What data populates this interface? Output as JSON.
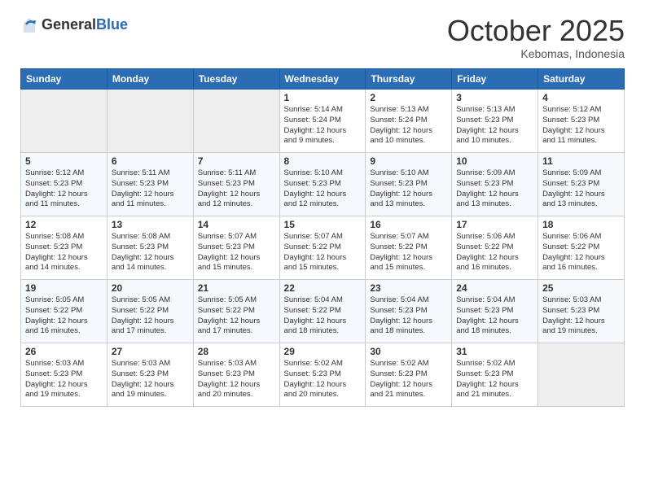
{
  "header": {
    "logo_general": "General",
    "logo_blue": "Blue",
    "month": "October 2025",
    "location": "Kebomas, Indonesia"
  },
  "days_of_week": [
    "Sunday",
    "Monday",
    "Tuesday",
    "Wednesday",
    "Thursday",
    "Friday",
    "Saturday"
  ],
  "weeks": [
    [
      {
        "day": "",
        "info": ""
      },
      {
        "day": "",
        "info": ""
      },
      {
        "day": "",
        "info": ""
      },
      {
        "day": "1",
        "info": "Sunrise: 5:14 AM\nSunset: 5:24 PM\nDaylight: 12 hours\nand 9 minutes."
      },
      {
        "day": "2",
        "info": "Sunrise: 5:13 AM\nSunset: 5:24 PM\nDaylight: 12 hours\nand 10 minutes."
      },
      {
        "day": "3",
        "info": "Sunrise: 5:13 AM\nSunset: 5:23 PM\nDaylight: 12 hours\nand 10 minutes."
      },
      {
        "day": "4",
        "info": "Sunrise: 5:12 AM\nSunset: 5:23 PM\nDaylight: 12 hours\nand 11 minutes."
      }
    ],
    [
      {
        "day": "5",
        "info": "Sunrise: 5:12 AM\nSunset: 5:23 PM\nDaylight: 12 hours\nand 11 minutes."
      },
      {
        "day": "6",
        "info": "Sunrise: 5:11 AM\nSunset: 5:23 PM\nDaylight: 12 hours\nand 11 minutes."
      },
      {
        "day": "7",
        "info": "Sunrise: 5:11 AM\nSunset: 5:23 PM\nDaylight: 12 hours\nand 12 minutes."
      },
      {
        "day": "8",
        "info": "Sunrise: 5:10 AM\nSunset: 5:23 PM\nDaylight: 12 hours\nand 12 minutes."
      },
      {
        "day": "9",
        "info": "Sunrise: 5:10 AM\nSunset: 5:23 PM\nDaylight: 12 hours\nand 13 minutes."
      },
      {
        "day": "10",
        "info": "Sunrise: 5:09 AM\nSunset: 5:23 PM\nDaylight: 12 hours\nand 13 minutes."
      },
      {
        "day": "11",
        "info": "Sunrise: 5:09 AM\nSunset: 5:23 PM\nDaylight: 12 hours\nand 13 minutes."
      }
    ],
    [
      {
        "day": "12",
        "info": "Sunrise: 5:08 AM\nSunset: 5:23 PM\nDaylight: 12 hours\nand 14 minutes."
      },
      {
        "day": "13",
        "info": "Sunrise: 5:08 AM\nSunset: 5:23 PM\nDaylight: 12 hours\nand 14 minutes."
      },
      {
        "day": "14",
        "info": "Sunrise: 5:07 AM\nSunset: 5:23 PM\nDaylight: 12 hours\nand 15 minutes."
      },
      {
        "day": "15",
        "info": "Sunrise: 5:07 AM\nSunset: 5:22 PM\nDaylight: 12 hours\nand 15 minutes."
      },
      {
        "day": "16",
        "info": "Sunrise: 5:07 AM\nSunset: 5:22 PM\nDaylight: 12 hours\nand 15 minutes."
      },
      {
        "day": "17",
        "info": "Sunrise: 5:06 AM\nSunset: 5:22 PM\nDaylight: 12 hours\nand 16 minutes."
      },
      {
        "day": "18",
        "info": "Sunrise: 5:06 AM\nSunset: 5:22 PM\nDaylight: 12 hours\nand 16 minutes."
      }
    ],
    [
      {
        "day": "19",
        "info": "Sunrise: 5:05 AM\nSunset: 5:22 PM\nDaylight: 12 hours\nand 16 minutes."
      },
      {
        "day": "20",
        "info": "Sunrise: 5:05 AM\nSunset: 5:22 PM\nDaylight: 12 hours\nand 17 minutes."
      },
      {
        "day": "21",
        "info": "Sunrise: 5:05 AM\nSunset: 5:22 PM\nDaylight: 12 hours\nand 17 minutes."
      },
      {
        "day": "22",
        "info": "Sunrise: 5:04 AM\nSunset: 5:22 PM\nDaylight: 12 hours\nand 18 minutes."
      },
      {
        "day": "23",
        "info": "Sunrise: 5:04 AM\nSunset: 5:23 PM\nDaylight: 12 hours\nand 18 minutes."
      },
      {
        "day": "24",
        "info": "Sunrise: 5:04 AM\nSunset: 5:23 PM\nDaylight: 12 hours\nand 18 minutes."
      },
      {
        "day": "25",
        "info": "Sunrise: 5:03 AM\nSunset: 5:23 PM\nDaylight: 12 hours\nand 19 minutes."
      }
    ],
    [
      {
        "day": "26",
        "info": "Sunrise: 5:03 AM\nSunset: 5:23 PM\nDaylight: 12 hours\nand 19 minutes."
      },
      {
        "day": "27",
        "info": "Sunrise: 5:03 AM\nSunset: 5:23 PM\nDaylight: 12 hours\nand 19 minutes."
      },
      {
        "day": "28",
        "info": "Sunrise: 5:03 AM\nSunset: 5:23 PM\nDaylight: 12 hours\nand 20 minutes."
      },
      {
        "day": "29",
        "info": "Sunrise: 5:02 AM\nSunset: 5:23 PM\nDaylight: 12 hours\nand 20 minutes."
      },
      {
        "day": "30",
        "info": "Sunrise: 5:02 AM\nSunset: 5:23 PM\nDaylight: 12 hours\nand 21 minutes."
      },
      {
        "day": "31",
        "info": "Sunrise: 5:02 AM\nSunset: 5:23 PM\nDaylight: 12 hours\nand 21 minutes."
      },
      {
        "day": "",
        "info": ""
      }
    ]
  ]
}
